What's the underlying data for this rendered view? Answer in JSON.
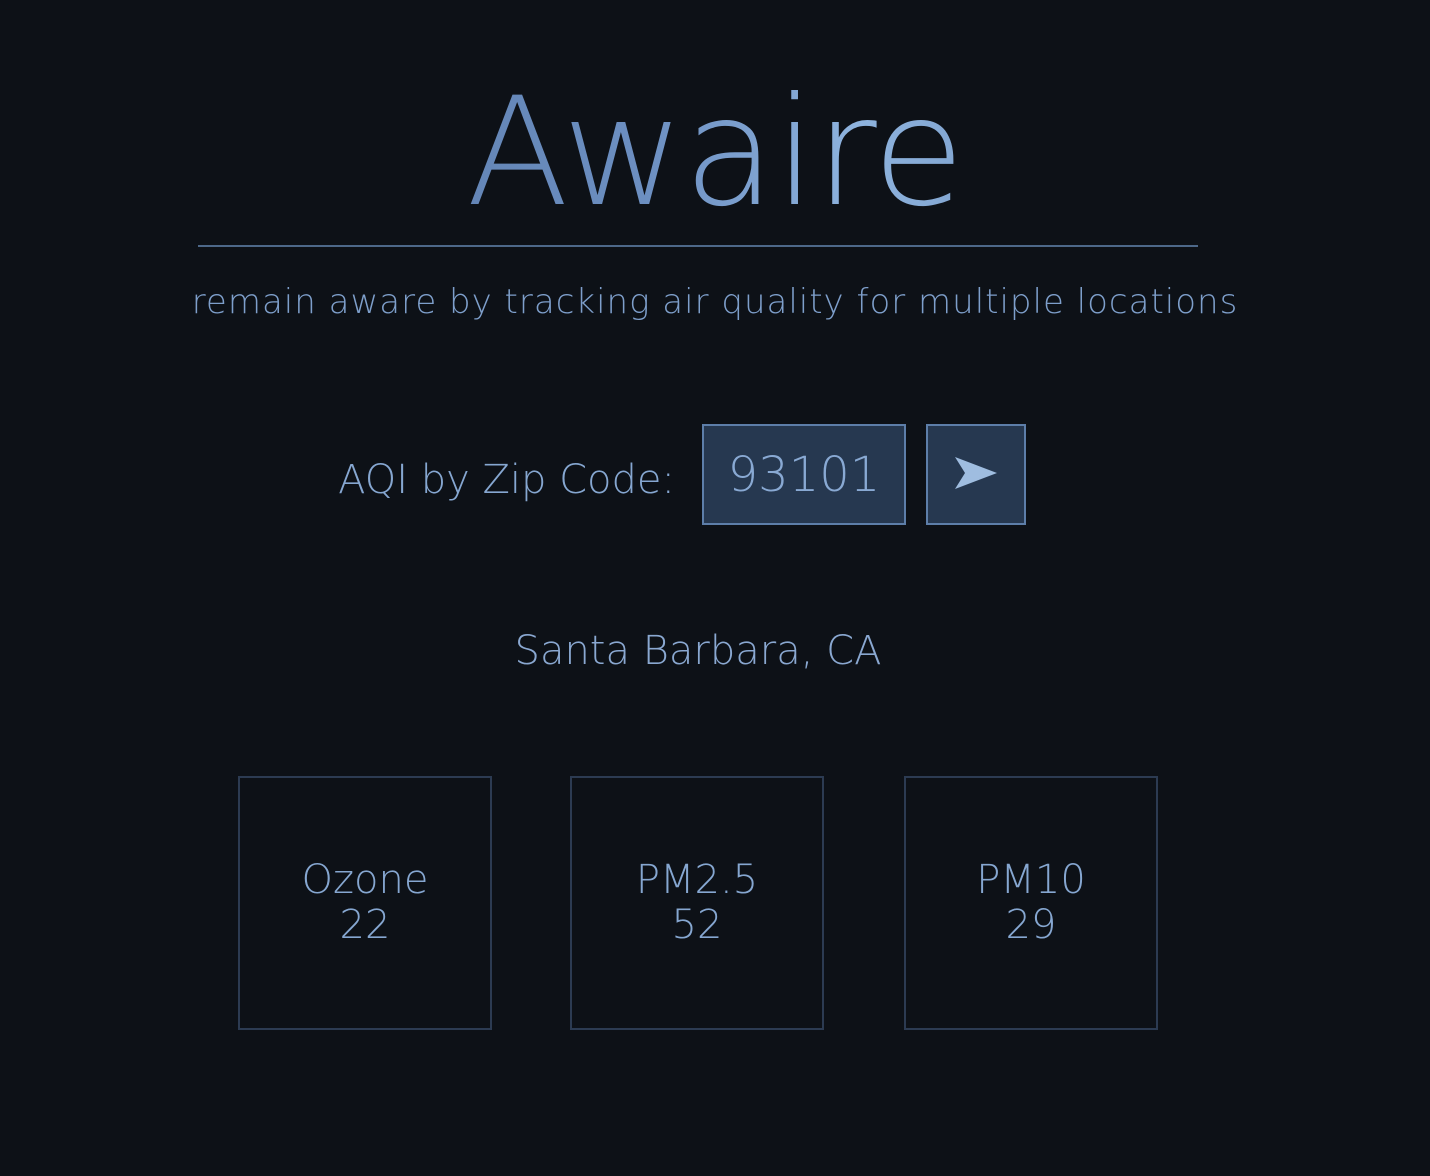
{
  "app": {
    "title": "Awaire",
    "tagline": "remain aware by tracking air quality for multiple locations"
  },
  "search": {
    "label": "AQI by Zip Code:",
    "zip_value": "93101",
    "submit_icon": "arrow-right-icon"
  },
  "result": {
    "location": "Santa Barbara, CA",
    "readings": [
      {
        "name": "Ozone",
        "value": "22"
      },
      {
        "name": "PM2.5",
        "value": "52"
      },
      {
        "name": "PM10",
        "value": "29"
      }
    ]
  },
  "colors": {
    "background": "#0d1117",
    "accent": "#86a7d1",
    "input_background": "#263850",
    "card_border": "#2c3b52"
  }
}
